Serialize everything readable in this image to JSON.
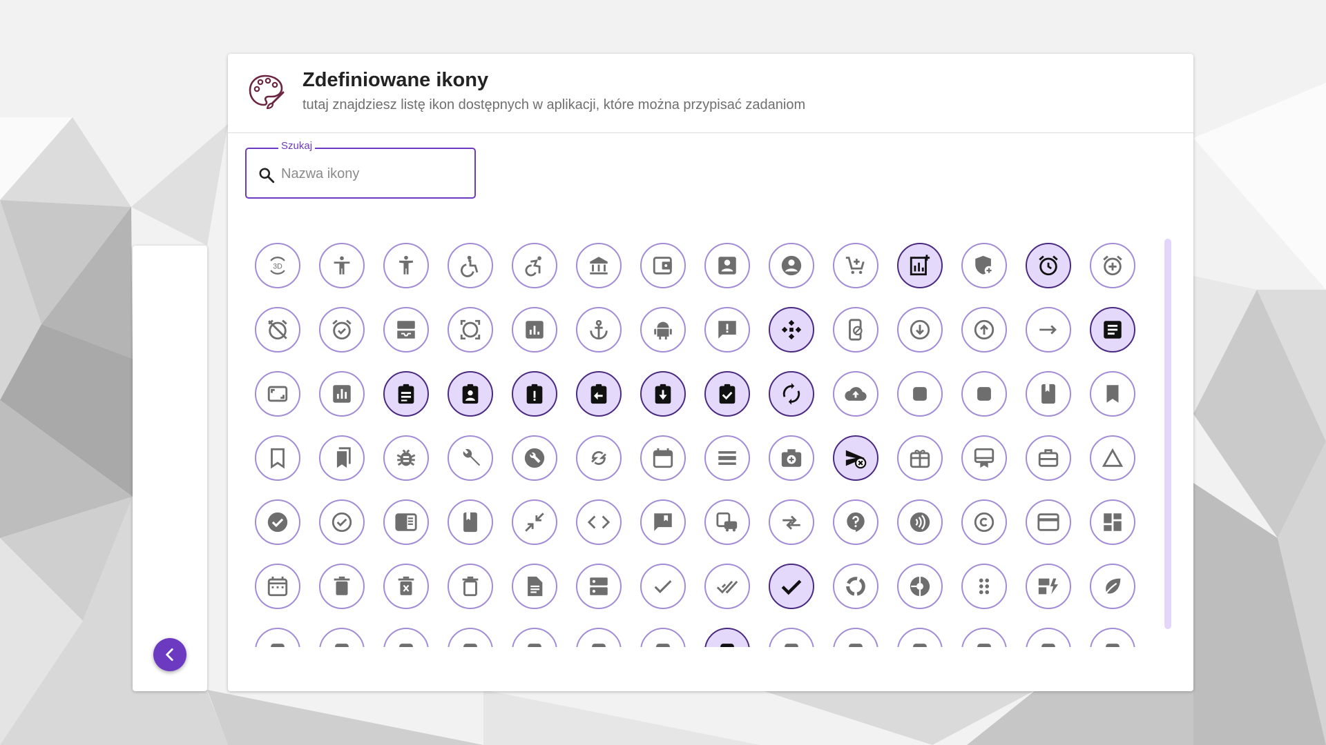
{
  "colors": {
    "accent": "#6c3ac0",
    "icon_border": "#a28cd6",
    "selected_bg": "#e5d9fb",
    "icon_glyph": "#6e6e6e"
  },
  "header": {
    "icon": "palette-brush-icon",
    "title": "Zdefiniowane ikony",
    "subtitle": "tutaj znajdziesz listę ikon dostępnych w aplikacji, które można przypisać zadaniom"
  },
  "search": {
    "label": "Szukaj",
    "placeholder": "Nazwa ikony",
    "value": ""
  },
  "sidebar": {
    "toggle_icon": "chevron-left-icon"
  },
  "icons": [
    [
      "3d-rotation",
      "accessibility",
      "accessibility-new",
      "accessible",
      "accessible-forward",
      "account-balance",
      "account-balance-wallet",
      "account-box",
      "account-circle",
      "add-shopping-cart",
      "add-chart",
      "add-moderator",
      "alarm",
      "alarm-add"
    ],
    [
      "alarm-off",
      "alarm-on",
      "all-inbox",
      "all-out",
      "analytics",
      "anchor",
      "android",
      "announcement",
      "api",
      "app-blocking",
      "arrow-circle-down",
      "arrow-circle-up",
      "arrow-right-alt",
      "article"
    ],
    [
      "aspect-ratio",
      "assessment",
      "assignment",
      "assignment-ind",
      "assignment-late",
      "assignment-return",
      "assignment-returned",
      "assignment-turned-in",
      "autorenew",
      "backup",
      "batch-prediction",
      "book-online",
      "book",
      "bookmark"
    ],
    [
      "bookmark-border",
      "bookmarks",
      "bug-report",
      "build",
      "build-circle",
      "cached",
      "calendar-today",
      "calendar-view-day",
      "camera-enhance",
      "cancel-schedule-send",
      "card-giftcard",
      "card-membership",
      "card-travel",
      "change-history"
    ],
    [
      "check-circle",
      "check-circle-outline",
      "chrome-reader-mode",
      "class",
      "close-fullscreen",
      "code",
      "comment-bank",
      "commute",
      "compare-arrows",
      "contact-support",
      "contactless",
      "copyright",
      "credit-card",
      "dashboard"
    ],
    [
      "date-range",
      "delete",
      "delete-forever",
      "delete-outline",
      "description",
      "dns",
      "done",
      "done-all",
      "done-outline",
      "donut-large",
      "donut-small",
      "drag-indicator",
      "dynamic-form",
      "eco"
    ],
    [
      "eject",
      "euro-symbol",
      "event",
      "event-seat",
      "exit-to-app",
      "explore",
      "explore-off",
      "extension",
      "face",
      "feed",
      "favorite",
      "favorite-border",
      "fact-check",
      "filter-alt"
    ]
  ],
  "selected": [
    "add-chart",
    "alarm",
    "api",
    "article",
    "assignment",
    "assignment-ind",
    "assignment-late",
    "assignment-return",
    "assignment-returned",
    "assignment-turned-in",
    "autorenew",
    "cancel-schedule-send",
    "done-outline",
    "extension"
  ]
}
